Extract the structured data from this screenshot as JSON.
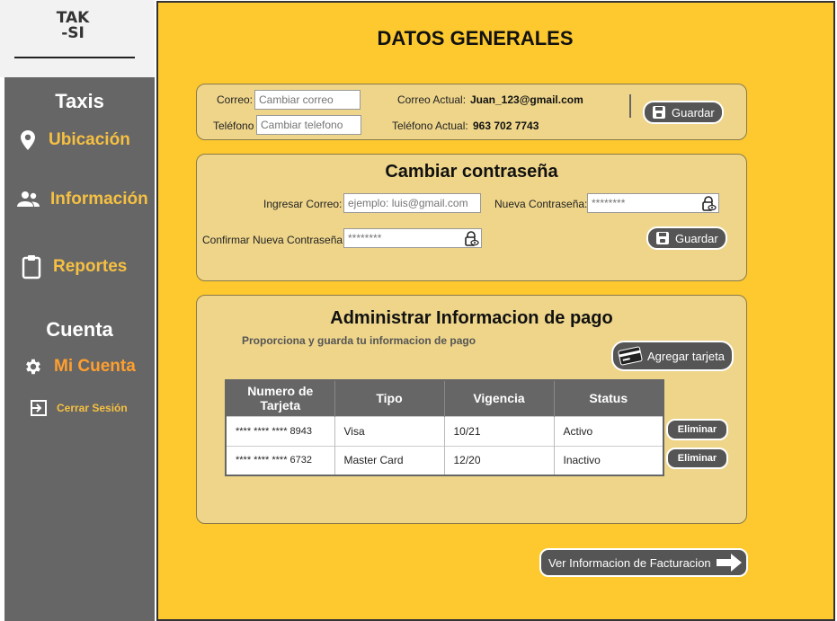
{
  "logo": {
    "line1": "TAK",
    "line2": "-SI"
  },
  "sidebar": {
    "section_taxis": "Taxis",
    "ubicacion": "Ubicación",
    "informacion": "Información",
    "reportes": "Reportes",
    "section_cuenta": "Cuenta",
    "mi_cuenta": "Mi Cuenta",
    "cerrar_sesion": "Cerrar Sesión"
  },
  "page_title": "DATOS GENERALES",
  "general": {
    "correo_label": "Correo:",
    "correo_placeholder": "Cambiar correo",
    "telefono_label": "Teléfono",
    "telefono_placeholder": "Cambiar telefono",
    "correo_actual_label": "Correo Actual:",
    "correo_actual_value": "Juan_123@gmail.com",
    "telefono_actual_label": "Teléfono Actual:",
    "telefono_actual_value": "963 702 7743",
    "save_label": "Guardar"
  },
  "password": {
    "title": "Cambiar contraseña",
    "email_label": "Ingresar Correo:",
    "email_placeholder": "ejemplo: luis@gmail.com",
    "new_label": "Nueva Contraseña:",
    "new_placeholder": "********",
    "confirm_label": "Confirmar Nueva Contraseña",
    "confirm_placeholder": "********",
    "save_label": "Guardar"
  },
  "payment": {
    "title": "Administrar Informacion de pago",
    "subtitle": "Proporciona y guarda tu informacion de pago",
    "add_label": "Agregar tarjeta",
    "headers": [
      "Numero de Tarjeta",
      "Tipo",
      "Vigencia",
      "Status"
    ],
    "rows": [
      {
        "numero": "**** **** **** 8943",
        "tipo": "Visa",
        "vigencia": "10/21",
        "status": "Activo"
      },
      {
        "numero": "**** **** **** 6732",
        "tipo": "Master Card",
        "vigencia": "12/20",
        "status": "Inactivo"
      }
    ],
    "delete_label": "Eliminar"
  },
  "billing_button": "Ver Informacion de Facturacion",
  "colors": {
    "accent": "#fdc92e",
    "sidebar": "#666666",
    "highlight": "#f6c042"
  }
}
